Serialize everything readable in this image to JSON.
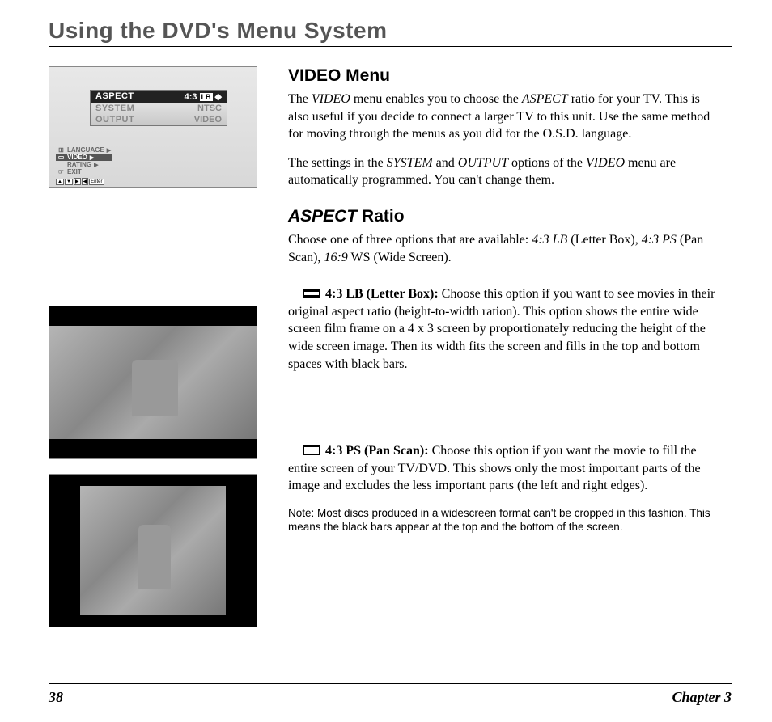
{
  "page_title": "Using the DVD's Menu System",
  "footer": {
    "page": "38",
    "chapter": "Chapter 3"
  },
  "osd": {
    "rows": [
      {
        "label": "ASPECT",
        "value": "4:3",
        "tag": "LB",
        "selected": true
      },
      {
        "label": "SYSTEM",
        "value": "NTSC",
        "tag": "",
        "selected": false
      },
      {
        "label": "OUTPUT",
        "value": "VIDEO",
        "tag": "",
        "selected": false
      }
    ],
    "sidebar": [
      {
        "icon": "⊞",
        "label": "LANGUAGE",
        "selected": false
      },
      {
        "icon": "▭",
        "label": "VIDEO",
        "selected": true
      },
      {
        "icon": "",
        "label": "RATING",
        "selected": false
      },
      {
        "icon": "☞",
        "label": "EXIT",
        "selected": false
      }
    ],
    "footer_keys": [
      "▲",
      "▼",
      "▶",
      "◀",
      "Enter"
    ]
  },
  "section1": {
    "heading": "VIDEO Menu",
    "p1_a": "The ",
    "p1_b": "VIDEO",
    "p1_c": " menu enables you to choose the ",
    "p1_d": "ASPECT",
    "p1_e": " ratio for your TV.  This is also useful if you decide to connect a larger TV to this unit. Use the same method for moving through the menus as you did for the O.S.D. language.",
    "p2_a": "The settings in the ",
    "p2_b": "SYSTEM",
    "p2_c": " and ",
    "p2_d": "OUTPUT",
    "p2_e": " options of the ",
    "p2_f": "VIDEO",
    "p2_g": " menu are automatically programmed. You can't change them."
  },
  "section2": {
    "heading_ital": "ASPECT",
    "heading_rest": " Ratio",
    "p_a": "Choose one of three options that are available: ",
    "p_b": "4:3 LB",
    "p_c": " (Letter Box), ",
    "p_d": "4:3 PS",
    "p_e": " (Pan Scan), ",
    "p_f": "16:9",
    "p_g": " WS (Wide Screen)."
  },
  "opt_lb": {
    "label": "4:3 LB (Letter Box):",
    "text": " Choose this option if you want to see movies in their original aspect ratio (height-to-width ration). This option shows the entire wide screen film frame on a 4 x 3 screen by proportionately reducing the height of the wide screen image. Then its width fits the screen and fills in the top and bottom spaces with black bars."
  },
  "opt_ps": {
    "label": "4:3 PS (Pan Scan):",
    "text": " Choose this option if you want the movie to fill the entire screen of your TV/DVD.  This shows only the most important parts of the image and excludes the less important parts (the left and right edges)."
  },
  "note": "Note:  Most discs produced in a widescreen format can't be cropped in this fashion. This means the black bars appear at the top and the bottom of the screen."
}
